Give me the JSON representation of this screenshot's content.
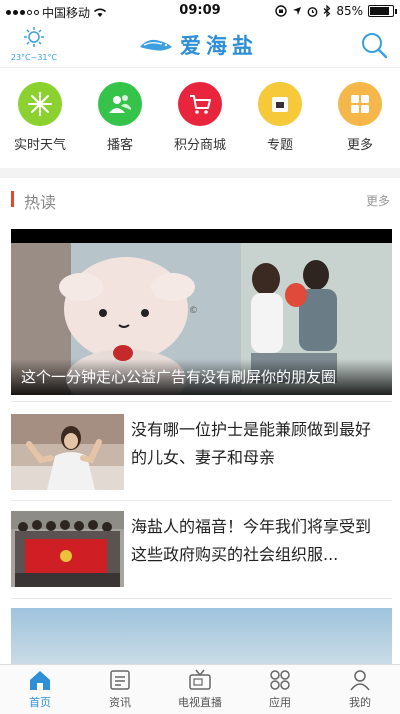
{
  "status_bar": {
    "carrier": "中国移动",
    "time": "09:09",
    "battery": "85%",
    "battery_level": 0.85
  },
  "header": {
    "weather_icon": "sun-icon",
    "temperature": "23°C~31°C",
    "app_title": "爱海盐",
    "logo_icon": "fish-logo-icon",
    "search_icon": "search-icon"
  },
  "quick_nav": [
    {
      "label": "实时天气",
      "icon": "snowflake-icon",
      "color": "#8bd12f"
    },
    {
      "label": "播客",
      "icon": "people-icon",
      "color": "#35c34a"
    },
    {
      "label": "积分商城",
      "icon": "cart-icon",
      "color": "#e8253d"
    },
    {
      "label": "专题",
      "icon": "folder-icon",
      "color": "#f5c93a"
    },
    {
      "label": "更多",
      "icon": "grid-icon",
      "color": "#f5b74a"
    }
  ],
  "section": {
    "title": "热读",
    "more": "更多"
  },
  "featured": {
    "caption": "这个一分钟走心公益广告有没有刷屏你的朋友圈"
  },
  "news": [
    {
      "title": "没有哪一位护士是能兼顾做到最好的儿女、妻子和母亲"
    },
    {
      "title": "海盐人的福音！今年我们将享受到这些政府购买的社会组织服..."
    }
  ],
  "tabbar": [
    {
      "label": "首页",
      "icon": "home-icon",
      "active": true
    },
    {
      "label": "资讯",
      "icon": "news-icon",
      "active": false
    },
    {
      "label": "电视直播",
      "icon": "tv-icon",
      "active": false
    },
    {
      "label": "应用",
      "icon": "apps-icon",
      "active": false
    },
    {
      "label": "我的",
      "icon": "profile-icon",
      "active": false
    }
  ],
  "colors": {
    "accent": "#2e8fd6",
    "section_marker": "#e8452c"
  }
}
